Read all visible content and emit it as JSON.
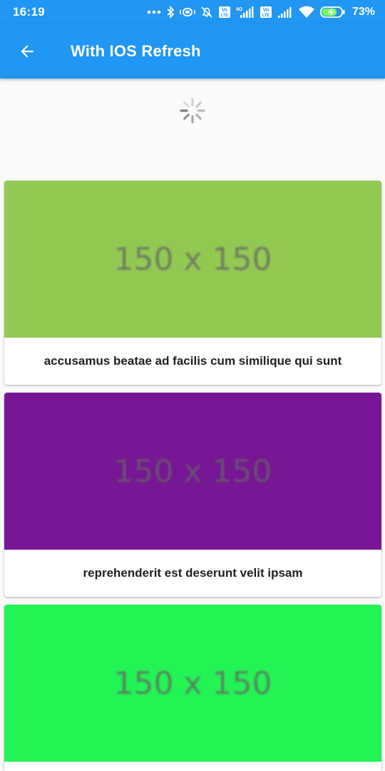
{
  "status_bar": {
    "time": "16:19",
    "battery": "73%",
    "icons": [
      "more-dots-icon",
      "bluetooth-icon",
      "vibrate-icon",
      "alarm-off-icon",
      "volte-icon",
      "signal-4g-icon",
      "volte-icon",
      "signal-icon",
      "wifi-icon",
      "battery-charging-icon"
    ]
  },
  "app_bar": {
    "title": "With IOS Refresh",
    "back_icon": "arrow-back-icon",
    "color": "#2196f3"
  },
  "refresh": {
    "icon": "activity-spinner-icon"
  },
  "items": [
    {
      "placeholder": "150 x 150",
      "color": "#92c952",
      "title": "accusamus beatae ad facilis cum similique qui sunt"
    },
    {
      "placeholder": "150 x 150",
      "color": "#771796",
      "title": "reprehenderit est deserunt velit ipsam"
    },
    {
      "placeholder": "150 x 150",
      "color": "#24f355",
      "title": ""
    }
  ]
}
